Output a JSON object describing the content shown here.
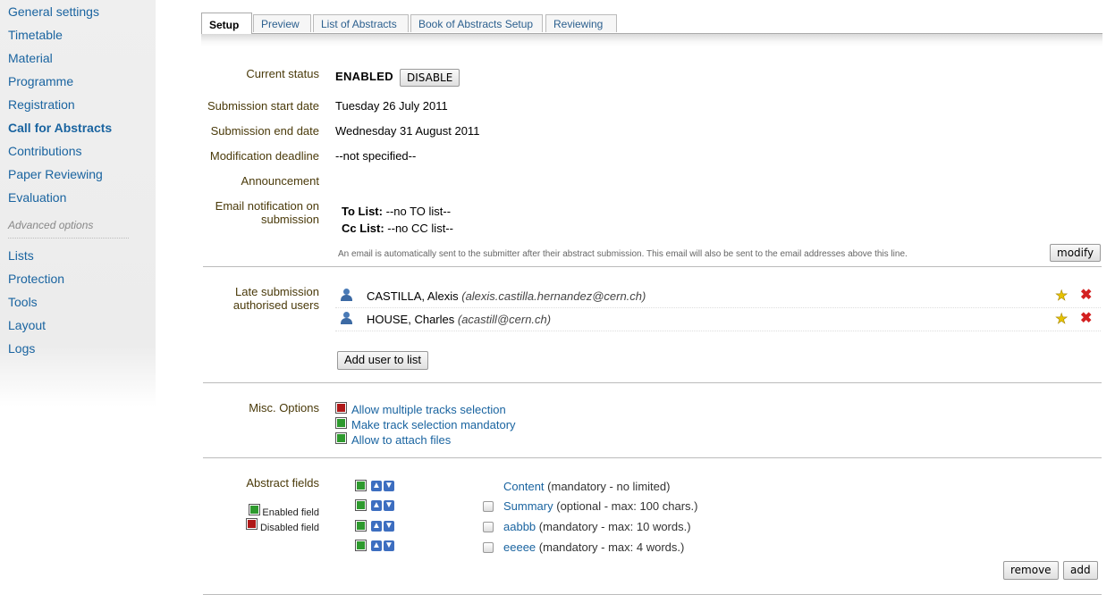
{
  "sidebar": {
    "items": [
      {
        "label": "General settings"
      },
      {
        "label": "Timetable"
      },
      {
        "label": "Material"
      },
      {
        "label": "Programme"
      },
      {
        "label": "Registration"
      },
      {
        "label": "Call for Abstracts"
      },
      {
        "label": "Contributions"
      },
      {
        "label": "Paper Reviewing"
      },
      {
        "label": "Evaluation"
      }
    ],
    "advanced_title": "Advanced options",
    "advanced_items": [
      {
        "label": "Lists"
      },
      {
        "label": "Protection"
      },
      {
        "label": "Tools"
      },
      {
        "label": "Layout"
      },
      {
        "label": "Logs"
      }
    ],
    "active": "Call for Abstracts"
  },
  "tabs": [
    {
      "label": "Setup",
      "active": true
    },
    {
      "label": "Preview"
    },
    {
      "label": "List of Abstracts"
    },
    {
      "label": "Book of Abstracts Setup"
    },
    {
      "label": "Reviewing"
    }
  ],
  "setup": {
    "current_status_label": "Current status",
    "current_status_value": "ENABLED",
    "disable_button": "DISABLE",
    "start_date_label": "Submission start date",
    "start_date_value": "Tuesday 26 July 2011",
    "end_date_label": "Submission end date",
    "end_date_value": "Wednesday 31 August 2011",
    "mod_deadline_label": "Modification deadline",
    "mod_deadline_value": "--not specified--",
    "announcement_label": "Announcement",
    "email_label_1": "Email notification on",
    "email_label_2": "submission",
    "to_list_label": "To List:",
    "to_list_value": "--no TO list--",
    "cc_list_label": "Cc List:",
    "cc_list_value": "--no CC list--",
    "email_note": "An email is automatically sent to the submitter after their abstract submission. This email will also be sent to the email addresses above this line.",
    "modify_button": "modify"
  },
  "late_submission": {
    "label_1": "Late submission",
    "label_2": "authorised users",
    "users": [
      {
        "name": "CASTILLA, Alexis",
        "email": "(alexis.castilla.hernandez@cern.ch)"
      },
      {
        "name": "HOUSE, Charles",
        "email": "(acastill@cern.ch)"
      }
    ],
    "add_button": "Add user to list"
  },
  "misc": {
    "label": "Misc. Options",
    "options": [
      {
        "label": "Allow multiple tracks selection",
        "enabled": false
      },
      {
        "label": "Make track selection mandatory",
        "enabled": true
      },
      {
        "label": "Allow to attach files",
        "enabled": true
      }
    ]
  },
  "abstract_fields": {
    "label": "Abstract fields",
    "legend_enabled": "Enabled field",
    "legend_disabled": "Disabled field",
    "fields": [
      {
        "name": "Content",
        "desc": "(mandatory - no limited)"
      },
      {
        "name": "Summary",
        "desc": "(optional - max: 100 chars.)"
      },
      {
        "name": "aabbb",
        "desc": "(mandatory - max: 10 words.)"
      },
      {
        "name": "eeeee",
        "desc": "(mandatory - max: 4 words.)"
      }
    ],
    "remove_button": "remove",
    "add_button": "add"
  },
  "colors": {
    "link": "#1a64a0",
    "label": "#4a3a0a",
    "enabled": "#2e9a2e",
    "disabled": "#b01818"
  }
}
